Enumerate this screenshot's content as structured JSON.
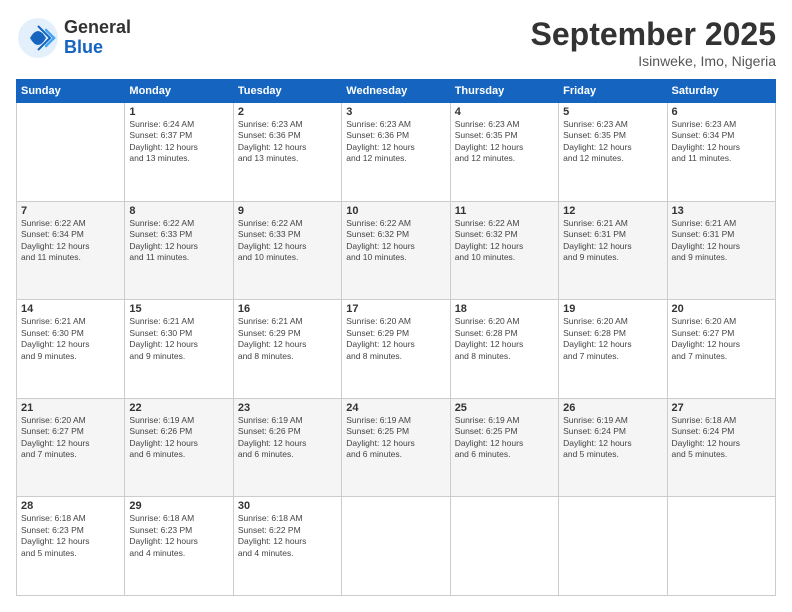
{
  "logo": {
    "general": "General",
    "blue": "Blue"
  },
  "header": {
    "month": "September 2025",
    "location": "Isinweke, Imo, Nigeria"
  },
  "days_of_week": [
    "Sunday",
    "Monday",
    "Tuesday",
    "Wednesday",
    "Thursday",
    "Friday",
    "Saturday"
  ],
  "weeks": [
    [
      {
        "day": "",
        "info": ""
      },
      {
        "day": "1",
        "info": "Sunrise: 6:24 AM\nSunset: 6:37 PM\nDaylight: 12 hours\nand 13 minutes."
      },
      {
        "day": "2",
        "info": "Sunrise: 6:23 AM\nSunset: 6:36 PM\nDaylight: 12 hours\nand 13 minutes."
      },
      {
        "day": "3",
        "info": "Sunrise: 6:23 AM\nSunset: 6:36 PM\nDaylight: 12 hours\nand 12 minutes."
      },
      {
        "day": "4",
        "info": "Sunrise: 6:23 AM\nSunset: 6:35 PM\nDaylight: 12 hours\nand 12 minutes."
      },
      {
        "day": "5",
        "info": "Sunrise: 6:23 AM\nSunset: 6:35 PM\nDaylight: 12 hours\nand 12 minutes."
      },
      {
        "day": "6",
        "info": "Sunrise: 6:23 AM\nSunset: 6:34 PM\nDaylight: 12 hours\nand 11 minutes."
      }
    ],
    [
      {
        "day": "7",
        "info": "Sunrise: 6:22 AM\nSunset: 6:34 PM\nDaylight: 12 hours\nand 11 minutes."
      },
      {
        "day": "8",
        "info": "Sunrise: 6:22 AM\nSunset: 6:33 PM\nDaylight: 12 hours\nand 11 minutes."
      },
      {
        "day": "9",
        "info": "Sunrise: 6:22 AM\nSunset: 6:33 PM\nDaylight: 12 hours\nand 10 minutes."
      },
      {
        "day": "10",
        "info": "Sunrise: 6:22 AM\nSunset: 6:32 PM\nDaylight: 12 hours\nand 10 minutes."
      },
      {
        "day": "11",
        "info": "Sunrise: 6:22 AM\nSunset: 6:32 PM\nDaylight: 12 hours\nand 10 minutes."
      },
      {
        "day": "12",
        "info": "Sunrise: 6:21 AM\nSunset: 6:31 PM\nDaylight: 12 hours\nand 9 minutes."
      },
      {
        "day": "13",
        "info": "Sunrise: 6:21 AM\nSunset: 6:31 PM\nDaylight: 12 hours\nand 9 minutes."
      }
    ],
    [
      {
        "day": "14",
        "info": "Sunrise: 6:21 AM\nSunset: 6:30 PM\nDaylight: 12 hours\nand 9 minutes."
      },
      {
        "day": "15",
        "info": "Sunrise: 6:21 AM\nSunset: 6:30 PM\nDaylight: 12 hours\nand 9 minutes."
      },
      {
        "day": "16",
        "info": "Sunrise: 6:21 AM\nSunset: 6:29 PM\nDaylight: 12 hours\nand 8 minutes."
      },
      {
        "day": "17",
        "info": "Sunrise: 6:20 AM\nSunset: 6:29 PM\nDaylight: 12 hours\nand 8 minutes."
      },
      {
        "day": "18",
        "info": "Sunrise: 6:20 AM\nSunset: 6:28 PM\nDaylight: 12 hours\nand 8 minutes."
      },
      {
        "day": "19",
        "info": "Sunrise: 6:20 AM\nSunset: 6:28 PM\nDaylight: 12 hours\nand 7 minutes."
      },
      {
        "day": "20",
        "info": "Sunrise: 6:20 AM\nSunset: 6:27 PM\nDaylight: 12 hours\nand 7 minutes."
      }
    ],
    [
      {
        "day": "21",
        "info": "Sunrise: 6:20 AM\nSunset: 6:27 PM\nDaylight: 12 hours\nand 7 minutes."
      },
      {
        "day": "22",
        "info": "Sunrise: 6:19 AM\nSunset: 6:26 PM\nDaylight: 12 hours\nand 6 minutes."
      },
      {
        "day": "23",
        "info": "Sunrise: 6:19 AM\nSunset: 6:26 PM\nDaylight: 12 hours\nand 6 minutes."
      },
      {
        "day": "24",
        "info": "Sunrise: 6:19 AM\nSunset: 6:25 PM\nDaylight: 12 hours\nand 6 minutes."
      },
      {
        "day": "25",
        "info": "Sunrise: 6:19 AM\nSunset: 6:25 PM\nDaylight: 12 hours\nand 6 minutes."
      },
      {
        "day": "26",
        "info": "Sunrise: 6:19 AM\nSunset: 6:24 PM\nDaylight: 12 hours\nand 5 minutes."
      },
      {
        "day": "27",
        "info": "Sunrise: 6:18 AM\nSunset: 6:24 PM\nDaylight: 12 hours\nand 5 minutes."
      }
    ],
    [
      {
        "day": "28",
        "info": "Sunrise: 6:18 AM\nSunset: 6:23 PM\nDaylight: 12 hours\nand 5 minutes."
      },
      {
        "day": "29",
        "info": "Sunrise: 6:18 AM\nSunset: 6:23 PM\nDaylight: 12 hours\nand 4 minutes."
      },
      {
        "day": "30",
        "info": "Sunrise: 6:18 AM\nSunset: 6:22 PM\nDaylight: 12 hours\nand 4 minutes."
      },
      {
        "day": "",
        "info": ""
      },
      {
        "day": "",
        "info": ""
      },
      {
        "day": "",
        "info": ""
      },
      {
        "day": "",
        "info": ""
      }
    ]
  ]
}
